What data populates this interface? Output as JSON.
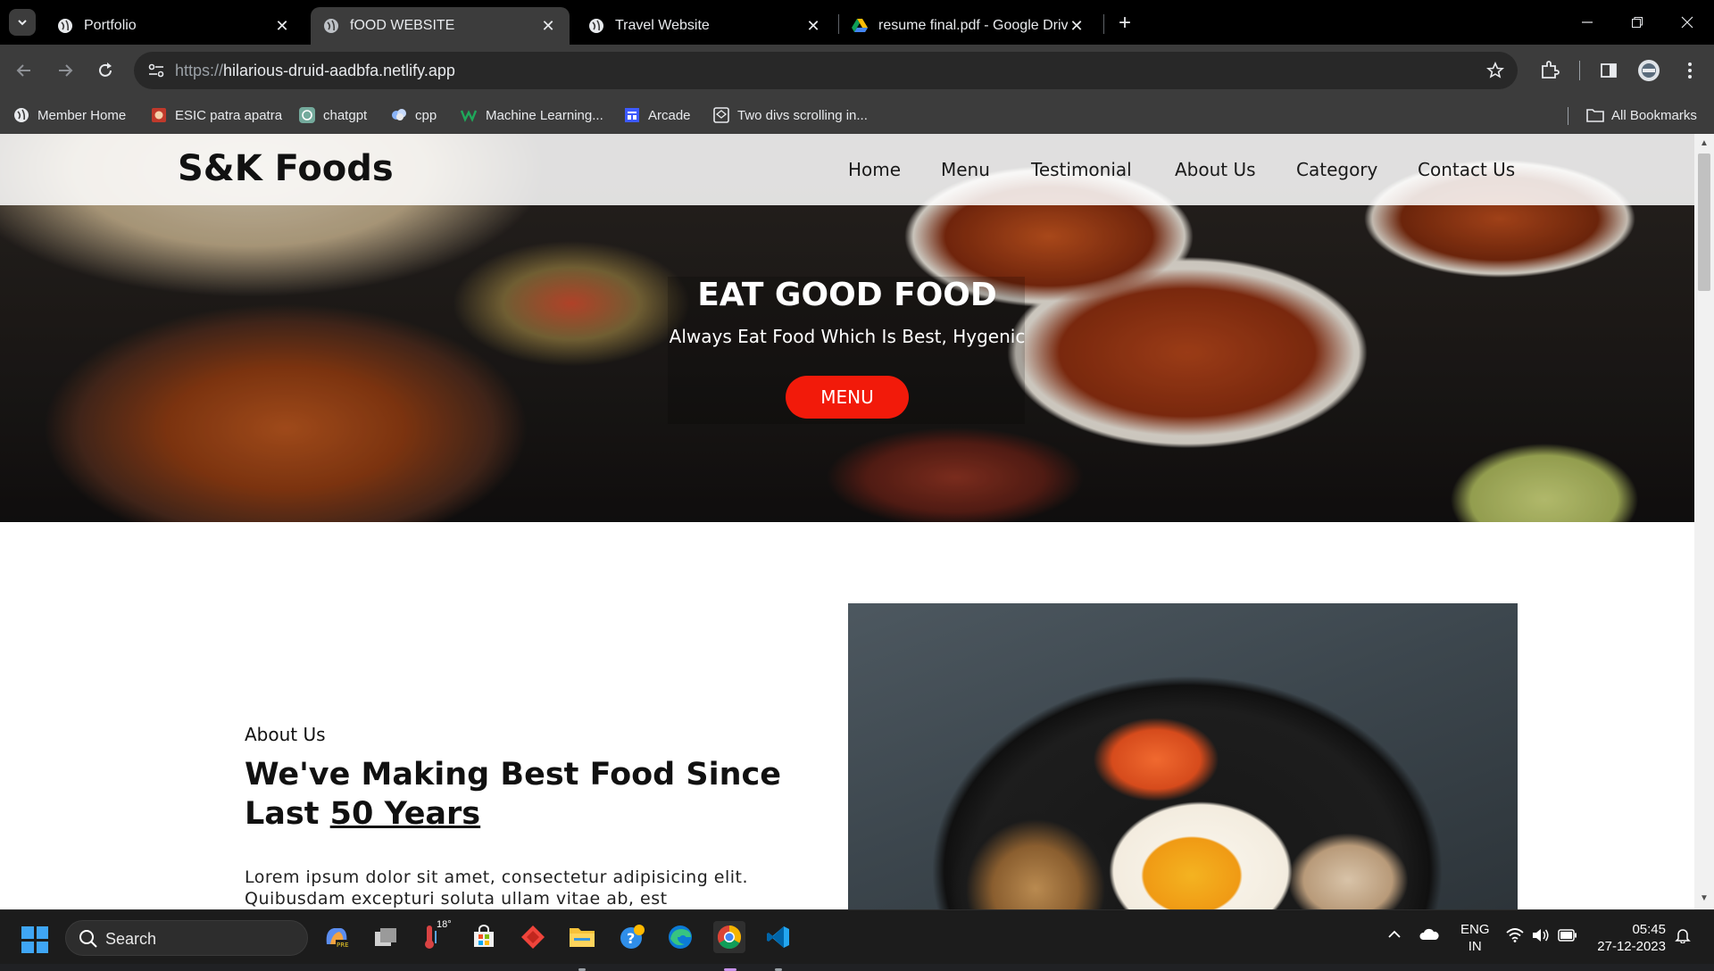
{
  "browser": {
    "tabs": [
      {
        "title": "Portfolio",
        "active": false
      },
      {
        "title": "fOOD WEBSITE",
        "active": true
      },
      {
        "title": "Travel Website",
        "active": false
      },
      {
        "title": "resume final.pdf - Google Drive",
        "active": false
      }
    ],
    "url_scheme": "https://",
    "url_host": "hilarious-druid-aadbfa.netlify.app",
    "bookmarks": [
      {
        "label": "Member Home",
        "icon": "globe-icon"
      },
      {
        "label": "ESIC patra apatra",
        "icon": "esic-icon"
      },
      {
        "label": "chatgpt",
        "icon": "chatgpt-icon"
      },
      {
        "label": "cpp",
        "icon": "cpp-icon"
      },
      {
        "label": "Machine Learning...",
        "icon": "ml-icon"
      },
      {
        "label": "Arcade",
        "icon": "arcade-icon"
      },
      {
        "label": "Two divs scrolling in...",
        "icon": "codepen-icon"
      }
    ],
    "all_bookmarks_label": "All Bookmarks"
  },
  "site": {
    "brand": "S&K Foods",
    "nav": [
      "Home",
      "Menu",
      "Testimonial",
      "About Us",
      "Category",
      "Contact Us"
    ],
    "hero": {
      "title": "EAT GOOD FOOD",
      "subtitle": "Always Eat Food Which Is Best, Hygenic",
      "button": "MENU"
    },
    "about": {
      "label": "About Us",
      "heading_part1": "We've Making Best Food Since Last ",
      "heading_highlight": "50 Years",
      "paragraph": "Lorem ipsum dolor sit amet, consectetur adipisicing elit. Quibusdam excepturi soluta ullam vitae ab, est"
    }
  },
  "taskbar": {
    "search_placeholder": "Search",
    "weather_temp": "18°",
    "lang_line1": "ENG",
    "lang_line2": "IN",
    "time": "05:45",
    "date": "27-12-2023"
  },
  "colors": {
    "accent_button": "#f21a0a",
    "chrome_dark": "#3c3c3c",
    "tab_bar": "#000000"
  }
}
